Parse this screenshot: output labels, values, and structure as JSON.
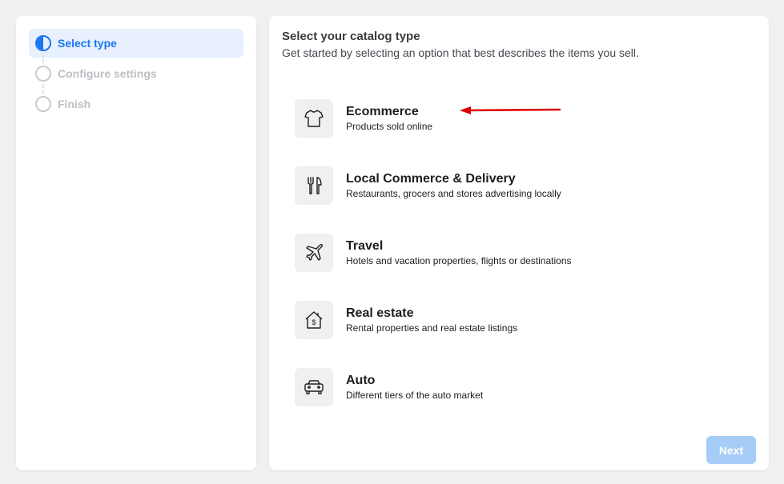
{
  "steps": [
    {
      "label": "Select type",
      "state": "active"
    },
    {
      "label": "Configure settings",
      "state": "inactive"
    },
    {
      "label": "Finish",
      "state": "inactive"
    }
  ],
  "main": {
    "title": "Select your catalog type",
    "subtitle": "Get started by selecting an option that best describes the items you sell."
  },
  "options": [
    {
      "name": "Ecommerce",
      "desc": "Products sold online",
      "icon": "shirt-icon"
    },
    {
      "name": "Local Commerce & Delivery",
      "desc": "Restaurants, grocers and stores advertising locally",
      "icon": "fork-knife-icon"
    },
    {
      "name": "Travel",
      "desc": "Hotels and vacation properties, flights or destinations",
      "icon": "airplane-icon"
    },
    {
      "name": "Real estate",
      "desc": "Rental properties and real estate listings",
      "icon": "house-dollar-icon"
    },
    {
      "name": "Auto",
      "desc": "Different tiers of the auto market",
      "icon": "car-icon"
    }
  ],
  "actions": {
    "next_label": "Next"
  },
  "colors": {
    "accent": "#1877f2",
    "annotation_arrow": "#e00000",
    "next_disabled": "#a6ccf8"
  }
}
